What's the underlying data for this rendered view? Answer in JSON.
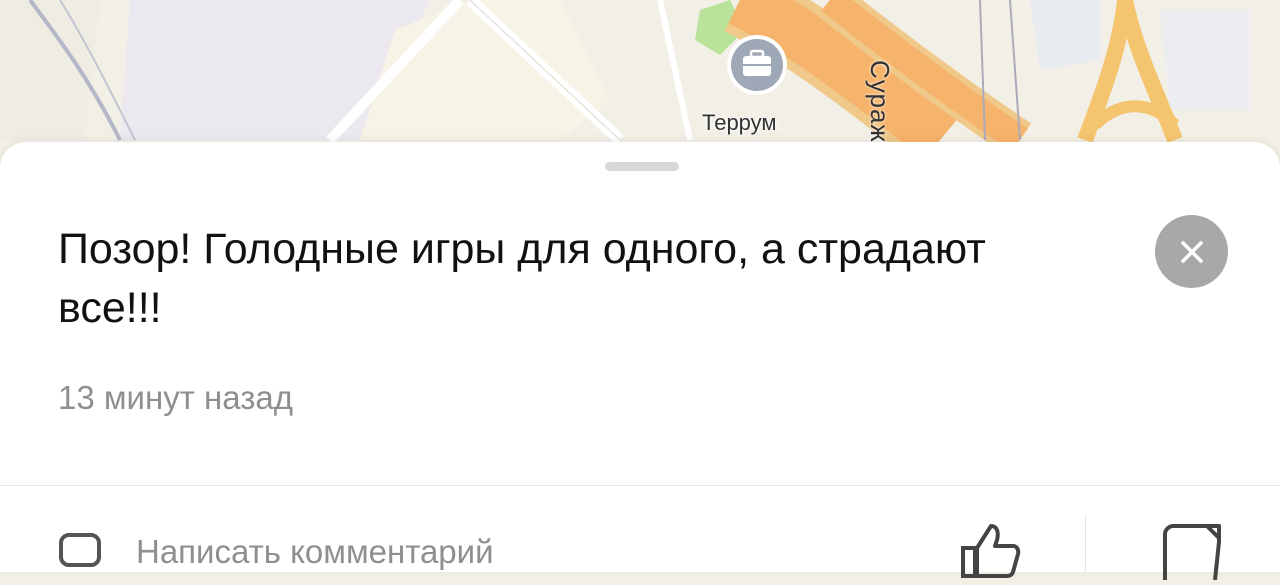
{
  "map": {
    "poi_label": "Террум",
    "street_label": "Сураж",
    "poi_icon": "briefcase-icon"
  },
  "sheet": {
    "message": "Позор! Голодные игры для одного, а страдают все!!!",
    "time_ago": "13 минут назад",
    "comment_placeholder": "Написать комментарий",
    "close_icon": "close-icon",
    "comment_icon": "comment-icon",
    "like_icon": "thumbs-up-icon",
    "share_icon": "share-icon"
  },
  "colors": {
    "map_background": "#f2efe6",
    "road_major": "#f6b36b",
    "road_minor": "#ffffff",
    "park": "#b9e39a",
    "poi_icon_background": "#9fa8b6",
    "close_button": "#a8a8a8",
    "secondary_text": "#8f8f8f"
  }
}
